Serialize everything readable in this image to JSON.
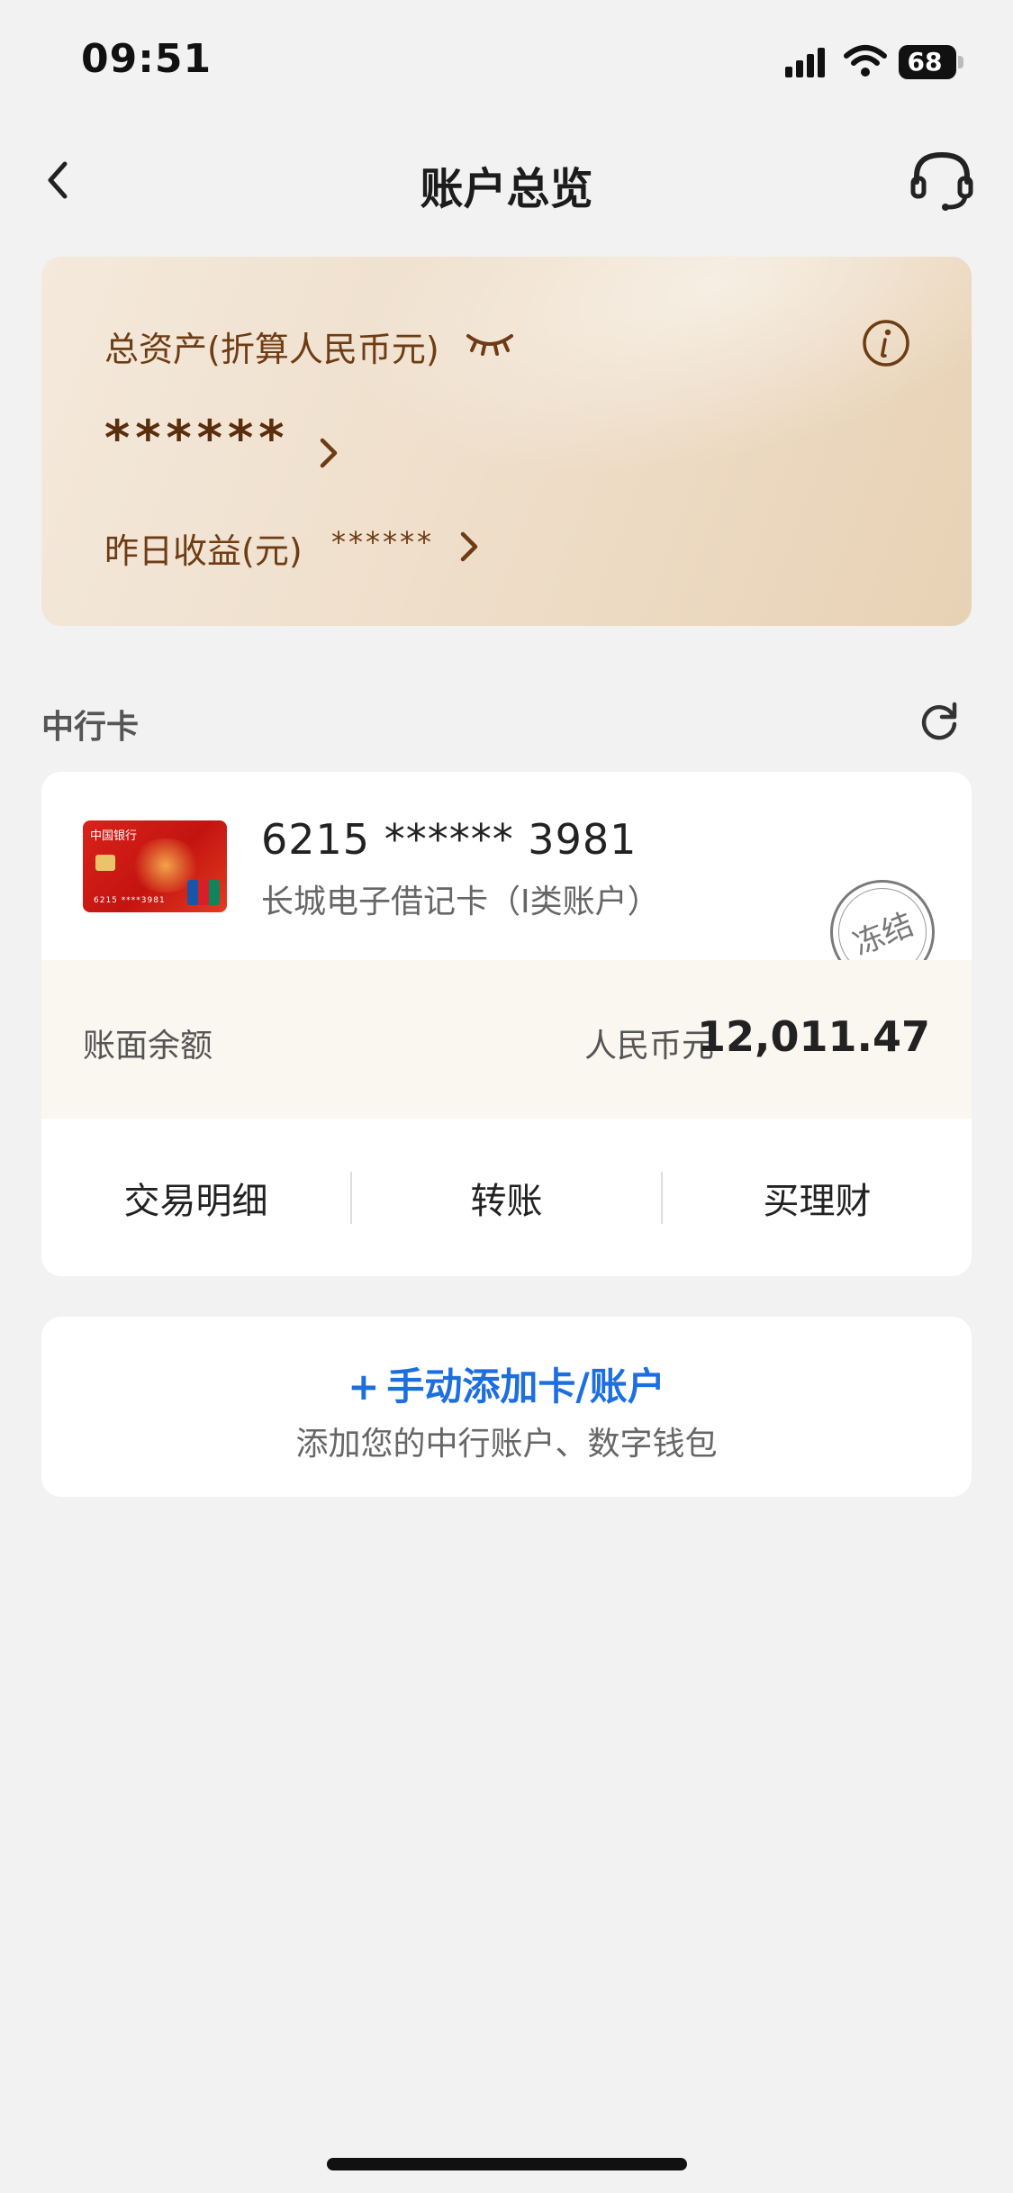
{
  "status_bar": {
    "time": "09:51",
    "battery": "68",
    "icons": [
      "signal-icon",
      "wifi-icon",
      "battery-icon"
    ]
  },
  "nav": {
    "title": "账户总览",
    "back_icon": "back-chevron-icon",
    "service_icon": "customer-service-headset-icon"
  },
  "asset_card": {
    "total_label": "总资产(折算人民币元)",
    "total_value": "******",
    "yesterday_label": "昨日收益(元)",
    "yesterday_value": "******"
  },
  "section": {
    "title": "中行卡"
  },
  "bank_card": {
    "thumb_logo": "中国银行",
    "thumb_number": "6215 ****3981",
    "number": "6215 ****** 3981",
    "type": "长城电子借记卡（I类账户）",
    "status_stamp": "冻结",
    "balance_label": "账面余额",
    "balance_currency": "人民币元",
    "balance_amount": "12,011.47",
    "actions": [
      "交易明细",
      "转账",
      "买理财"
    ]
  },
  "add_card": {
    "plus": "+",
    "title": "手动添加卡/账户",
    "subtitle": "添加您的中行账户、数字钱包"
  },
  "colors": {
    "accent_blue": "#1d6fe0",
    "asset_brown": "#6e3c14",
    "page_bg": "#f2f2f2"
  }
}
